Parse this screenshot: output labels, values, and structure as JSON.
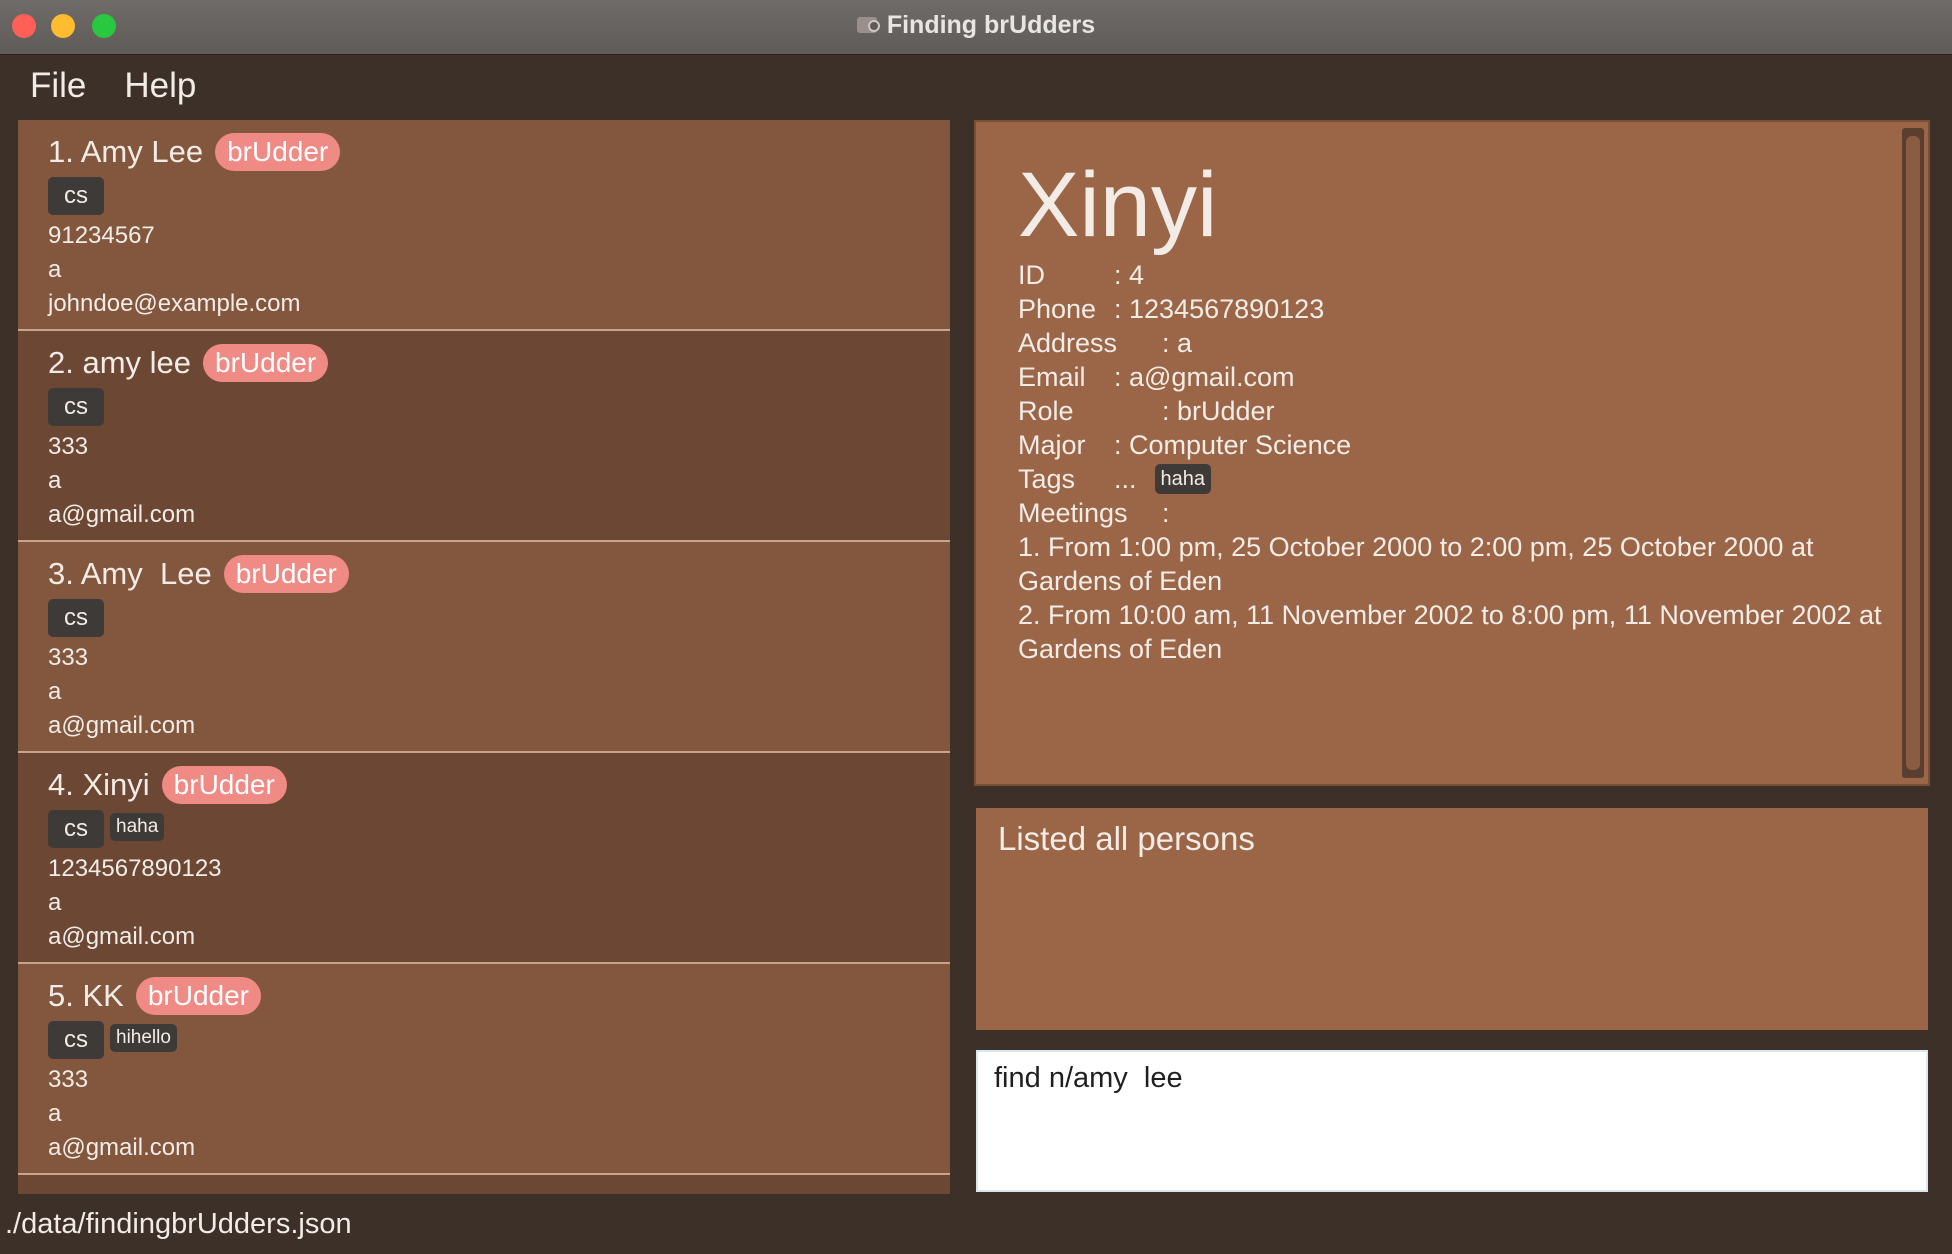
{
  "window": {
    "title": "Finding brUdders"
  },
  "menu": {
    "file": "File",
    "help": "Help"
  },
  "persons": [
    {
      "index_name": "1. Amy Lee",
      "role": "brUdder",
      "major": "cs",
      "tags": [],
      "phone": "91234567",
      "address": "a",
      "email": "johndoe@example.com"
    },
    {
      "index_name": "2. amy lee",
      "role": "brUdder",
      "major": "cs",
      "tags": [],
      "phone": "333",
      "address": "a",
      "email": "a@gmail.com"
    },
    {
      "index_name": "3. Amy  Lee",
      "role": "brUdder",
      "major": "cs",
      "tags": [],
      "phone": "333",
      "address": "a",
      "email": "a@gmail.com"
    },
    {
      "index_name": "4. Xinyi",
      "role": "brUdder",
      "major": "cs",
      "tags": [
        "haha"
      ],
      "phone": "1234567890123",
      "address": "a",
      "email": "a@gmail.com"
    },
    {
      "index_name": "5. KK",
      "role": "brUdder",
      "major": "cs",
      "tags": [
        "hihello"
      ],
      "phone": "333",
      "address": "a",
      "email": "a@gmail.com"
    }
  ],
  "detail": {
    "name": "Xinyi",
    "id_label": "ID",
    "id_value": ": 4",
    "phone_label": "Phone",
    "phone_value": ": 1234567890123",
    "address_label": "Address",
    "address_value": ": a",
    "email_label": "Email",
    "email_value": ": a@gmail.com",
    "role_label": "Role",
    "role_value": ": brUdder",
    "major_label": "Major",
    "major_value": ": Computer Science",
    "tags_label": "Tags",
    "tags_sep": "...",
    "tag": "haha",
    "meetings_label": "Meetings",
    "meetings_sep": ":",
    "meetings": [
      "1. From 1:00 pm, 25 October 2000 to 2:00 pm, 25 October 2000 at Gardens of Eden",
      "2. From 10:00 am, 11 November 2002 to 8:00 pm, 11 November 2002 at Gardens of Eden"
    ]
  },
  "result": {
    "text": "Listed all persons"
  },
  "command": {
    "value": "find n/amy  lee"
  },
  "status": {
    "path": "./data/findingbrUdders.json"
  }
}
